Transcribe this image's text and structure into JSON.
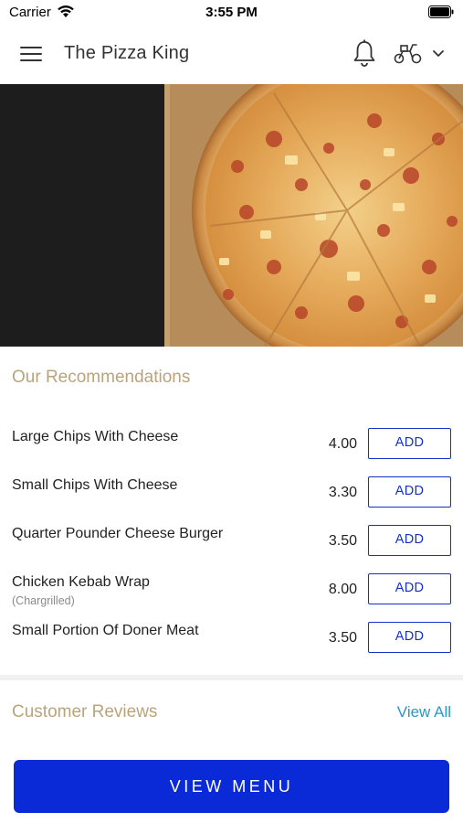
{
  "status_bar": {
    "carrier": "Carrier",
    "time": "3:55 PM"
  },
  "header": {
    "title": "The Pizza King",
    "menu_icon": "hamburger-menu-icon",
    "notification_icon": "bell-icon",
    "delivery_icon": "scooter-icon",
    "dropdown_icon": "chevron-down-icon"
  },
  "hero": {
    "image": "pizza-photo"
  },
  "recommendations": {
    "title": "Our Recommendations",
    "items": [
      {
        "name": "Large Chips With Cheese",
        "note": "",
        "price": "4.00",
        "button": "ADD"
      },
      {
        "name": "Small Chips With Cheese",
        "note": "",
        "price": "3.30",
        "button": "ADD"
      },
      {
        "name": "Quarter Pounder Cheese Burger",
        "note": "",
        "price": "3.50",
        "button": "ADD"
      },
      {
        "name": "Chicken Kebab Wrap",
        "note": "(Chargrilled)",
        "price": "8.00",
        "button": "ADD"
      },
      {
        "name": "Small Portion Of Doner Meat",
        "note": "",
        "price": "3.50",
        "button": "ADD"
      }
    ]
  },
  "reviews": {
    "title": "Customer Reviews",
    "view_all": "View All"
  },
  "footer": {
    "view_menu": "VIEW MENU"
  },
  "colors": {
    "accent_blue": "#1631c7",
    "primary_button": "#0a2ad8",
    "section_title": "#b9a47c",
    "link": "#2a97c7"
  }
}
